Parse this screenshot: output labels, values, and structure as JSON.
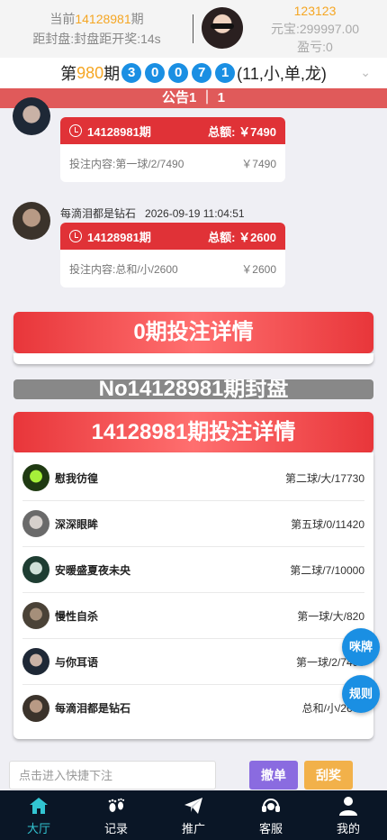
{
  "header": {
    "current_prefix": "当前",
    "current_period": "14128981",
    "current_suffix": "期",
    "countdown": "距封盘:封盘距开奖:14s",
    "user_id": "123123",
    "balance": "元宝:299997.00",
    "profit": "盈亏:0"
  },
  "draw": {
    "prefix": "第",
    "period": "980",
    "suffix": "期",
    "balls": [
      "3",
      "0",
      "0",
      "7",
      "1"
    ],
    "result": "(11,小,单,龙)"
  },
  "notice": "公告1 ｜ 1",
  "feed": [
    {
      "period": "14128981期",
      "total_label": "总额:",
      "total": "￥7490",
      "content": "投注内容:第一球/2/7490",
      "amount": "￥7490"
    },
    {
      "user": "每滴泪都是钻石",
      "time": "2026-09-19 11:04:51",
      "period": "14128981期",
      "total_label": "总额:",
      "total": "￥2600",
      "content": "投注内容:总和/小/2600",
      "amount": "￥2600"
    }
  ],
  "panels": {
    "zero_title": "0期投注详情",
    "closed_banner": "No14128981期封盘",
    "detail_title": "14128981期投注详情"
  },
  "details": [
    {
      "name": "慰我彷徨",
      "bet": "第二球/大/17730"
    },
    {
      "name": "深深眼眸",
      "bet": "第五球/0/11420"
    },
    {
      "name": "安暖盛夏夜未央",
      "bet": "第二球/7/10000"
    },
    {
      "name": "慢性自杀",
      "bet": "第一球/大/820"
    },
    {
      "name": "与你耳语",
      "bet": "第一球/2/7490"
    },
    {
      "name": "每滴泪都是钻石",
      "bet": "总和/小/2600"
    }
  ],
  "fabs": {
    "chat": "咪牌",
    "rules": "规则"
  },
  "quick": {
    "placeholder": "点击进入快捷下注",
    "cancel": "撤单",
    "scratch": "刮奖"
  },
  "tabs": [
    {
      "label": "大厅",
      "icon": "home-icon"
    },
    {
      "label": "记录",
      "icon": "footprints-icon"
    },
    {
      "label": "推广",
      "icon": "paper-plane-icon"
    },
    {
      "label": "客服",
      "icon": "headset-icon"
    },
    {
      "label": "我的",
      "icon": "user-icon"
    }
  ],
  "colors": {
    "accent_blue": "#1a8fe3",
    "brand_red": "#e03237",
    "highlight_orange": "#f5a623",
    "tab_active": "#32c5d2",
    "tab_bg": "#0a1626"
  }
}
